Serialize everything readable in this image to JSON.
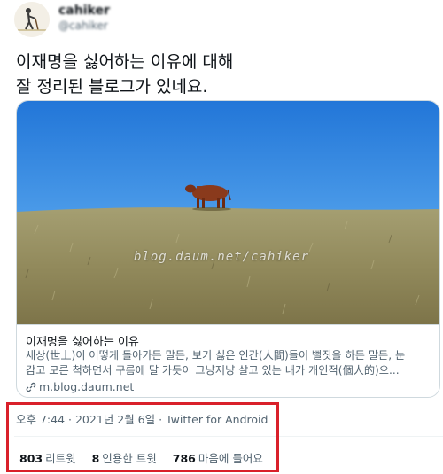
{
  "author": {
    "display_name": "cahiker",
    "handle": "@cahiker"
  },
  "tweet": {
    "text_line1": "이재명을 싫어하는 이유에 대해",
    "text_line2": "잘 정리된 블로그가 있네요."
  },
  "card": {
    "image_watermark": "blog.daum.net/cahiker",
    "title": "이재명을 싫어하는 이유",
    "desc_line1": "세상(世上)이 어떻게 돌아가든 말든, 보기 싫은 인간(人間)들이 뻘짓을 하든 말든, 눈",
    "desc_line2": "감고 모른 척하면서 구름에 달 가듯이 그냥저냥 살고 있는 내가 개인적(個人的)으...",
    "domain": "m.blog.daum.net"
  },
  "meta": {
    "time": "오후 7:44",
    "sep1": " · ",
    "date": "2021년 2월 6일",
    "sep2": " · ",
    "source": "Twitter for Android"
  },
  "stats": {
    "retweets_count": "803",
    "retweets_label": "리트윗",
    "quotes_count": "8",
    "quotes_label": "인용한 트윗",
    "likes_count": "786",
    "likes_label": "마음에 들어요"
  },
  "colors": {
    "highlight": "#d9202a",
    "sky": "#2f86e0",
    "field": "#9b9466"
  }
}
